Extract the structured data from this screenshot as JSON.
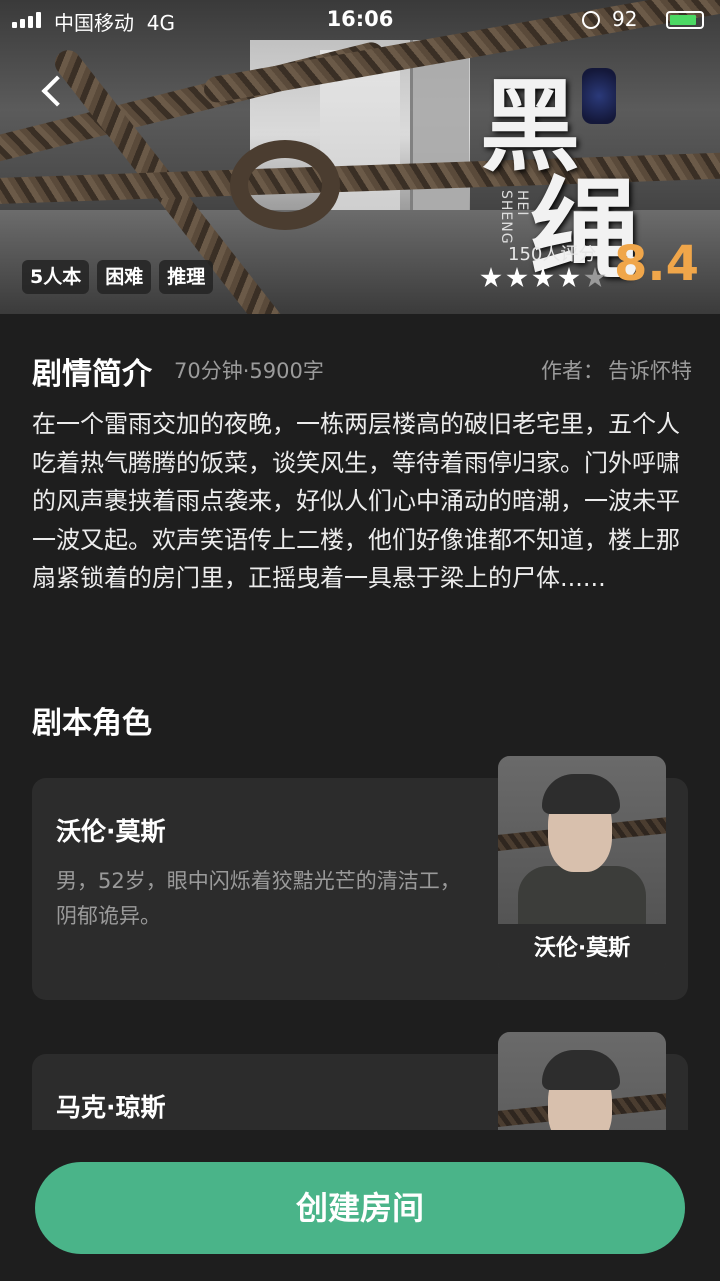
{
  "status_bar": {
    "carrier": "中国移动",
    "network": "4G",
    "time": "16:06",
    "battery_percent": "92"
  },
  "hero": {
    "title_art": {
      "chars": [
        "黑",
        "绳"
      ],
      "pinyin": "HEI SHENG"
    },
    "tags": [
      "5人本",
      "困难",
      "推理"
    ],
    "rating_count": "150人评分",
    "stars": {
      "filled": 4,
      "total": 5
    },
    "score": "8.4"
  },
  "synopsis_section": {
    "title": "剧情简介",
    "meta": "70分钟·5900字",
    "author_label": "作者：",
    "author_name": "告诉怀特",
    "text": "在一个雷雨交加的夜晚，一栋两层楼高的破旧老宅里，五个人吃着热气腾腾的饭菜，谈笑风生，等待着雨停归家。门外呼啸的风声裹挟着雨点袭来，好似人们心中涌动的暗潮，一波未平一波又起。欢声笑语传上二楼，他们好像谁都不知道，楼上那扇紧锁着的房门里，正摇曳着一具悬于梁上的尸体......"
  },
  "roles_section": {
    "title": "剧本角色",
    "roles": [
      {
        "name": "沃伦·莫斯",
        "desc": "男，52岁，眼中闪烁着狡黠光芒的清洁工，阴郁诡异。",
        "portrait_label": "沃伦·莫斯"
      },
      {
        "name": "马克·琼斯",
        "desc": "",
        "portrait_label": ""
      }
    ]
  },
  "actions": {
    "create_room": "创建房间"
  },
  "colors": {
    "background": "#1e1e1e",
    "card": "#2c2c2c",
    "accent_green": "#4ab489",
    "score_orange": "#f0a64a",
    "secondary_text": "#9b9b9b"
  },
  "icons": [
    "signal-icon",
    "lock-rotation-icon",
    "battery-icon",
    "back-arrow-icon",
    "star-icon"
  ]
}
